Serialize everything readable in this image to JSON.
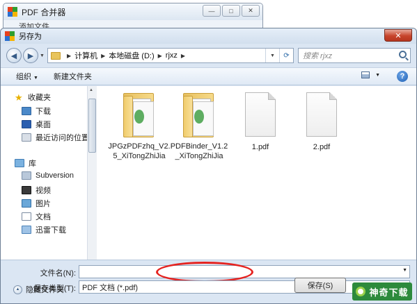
{
  "background_window": {
    "title": "PDF 合并器",
    "min": "—",
    "max": "□",
    "close": "✕",
    "toolbar_text": "添加文件"
  },
  "dialog": {
    "title": "另存为",
    "close_label": "✕",
    "breadcrumb": [
      "计算机",
      "本地磁盘 (D:)",
      "rjxz"
    ],
    "search_placeholder": "搜索 rjxz",
    "toolbar": {
      "organize": "组织",
      "new_folder": "新建文件夹",
      "help": "?"
    },
    "nav": {
      "favorites": {
        "label": "收藏夹",
        "items": [
          "下载",
          "桌面",
          "最近访问的位置"
        ]
      },
      "libraries": {
        "label": "库",
        "items": [
          "Subversion",
          "视频",
          "图片",
          "文档",
          "迅雷下载"
        ]
      }
    },
    "files": [
      {
        "line1": "JPGzPDFzhq_V2.",
        "line2": "5_XiTongZhiJia",
        "type": "folder"
      },
      {
        "line1": "PDFBinder_V1.2",
        "line2": "_XiTongZhiJia",
        "type": "folder"
      },
      {
        "line1": "1.pdf",
        "line2": "",
        "type": "pdf"
      },
      {
        "line1": "2.pdf",
        "line2": "",
        "type": "pdf"
      }
    ],
    "filename_label": "文件名(N):",
    "filename_value": "",
    "filetype_label": "保存类型(T):",
    "filetype_value": "PDF 文档 (*.pdf)",
    "hide_folders": "隐藏文件夹",
    "save_button": "保存(S)"
  },
  "watermark": "神奇下载",
  "colors": {
    "accent": "#2b6aa8",
    "close_red": "#c7432b",
    "annotation_red": "#e52320"
  }
}
